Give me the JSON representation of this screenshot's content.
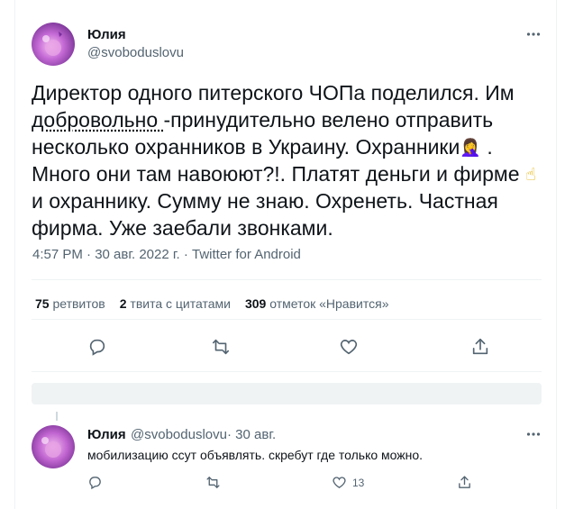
{
  "tweet": {
    "author_name": "Юлия",
    "author_handle": "@svoboduslovu",
    "text_part1": "Директор одного питерского ЧОПа поделился. Им ",
    "text_underlined": "добровольно ",
    "text_part2": "-принудительно велено отправить несколько охранников в Украину. Охранники",
    "emoji_facepalm": "🤦‍♀️",
    "text_part3": " . Много они там навоюют?!. Платят деньги и фирме ",
    "emoji_finger": "☝",
    "text_part4": "  и охраннику.  Сумму не знаю. Охренеть. Частная фирма. Уже заебали звонками.",
    "meta": "4:57 PM · 30 авг. 2022 г. · Twitter for Android",
    "stats": {
      "retweets_count": "75",
      "retweets_label": "ретвитов",
      "quotes_count": "2",
      "quotes_label": "твита с цитатами",
      "likes_count": "309",
      "likes_label": "отметок «Нравится»"
    },
    "actions": [
      "reply-icon",
      "retweet-icon",
      "like-icon",
      "share-icon"
    ]
  },
  "reply": {
    "author_name": "Юлия",
    "author_handle": "@svoboduslovu",
    "time": "· 30 авг.",
    "text": "мобилизацию ссут объявлять. скребут где только можно.",
    "likes_count": "13",
    "actions": [
      "reply-icon",
      "retweet-icon",
      "like-icon",
      "share-icon"
    ]
  },
  "colors": {
    "text": "#0f1419",
    "secondary": "#536471",
    "divider": "#eff3f4"
  }
}
